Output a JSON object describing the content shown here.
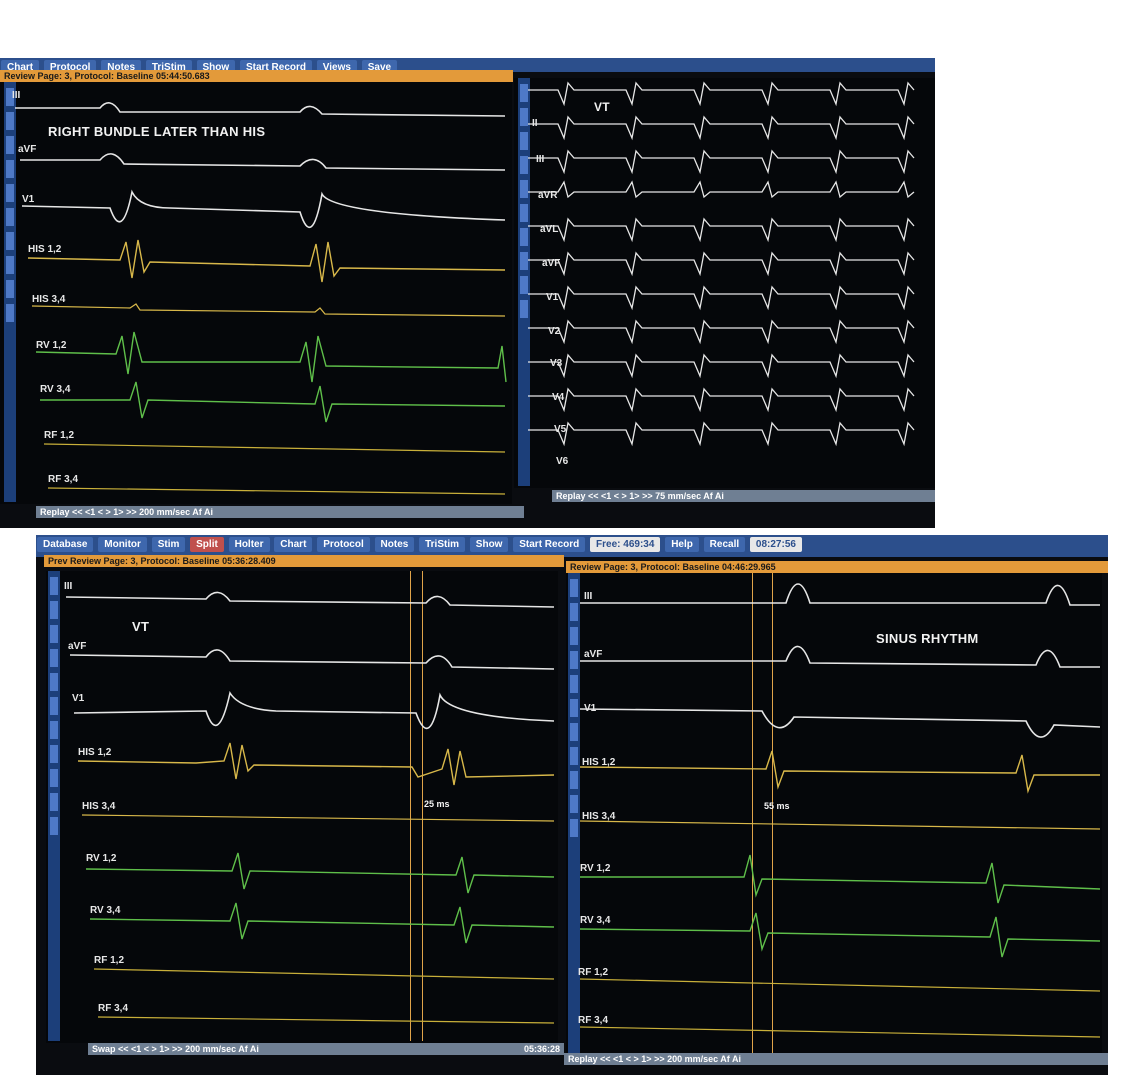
{
  "top_left": {
    "toolbar": [
      "Chart",
      "Protocol",
      "Notes",
      "TriStim",
      "Show",
      "Start Record",
      "Views",
      "Save"
    ],
    "title": "Review Page: 3, Protocol: Baseline  05:44:50.683",
    "note": "RIGHT BUNDLE  LATER THAN HIS",
    "leads": [
      "III",
      "aVF",
      "V1",
      "HIS 1,2",
      "HIS 3,4",
      "RV 1,2",
      "RV 3,4",
      "RF 1,2",
      "RF 3,4"
    ],
    "status": "Replay  <<  <1  <  >  1>  >>  200 mm/sec  Af  Ai"
  },
  "top_right": {
    "note": "VT",
    "leads": [
      "II",
      "III",
      "aVR",
      "aVL",
      "aVF",
      "V1",
      "V2",
      "V3",
      "V4",
      "V5",
      "V6"
    ],
    "status": "Replay  <<  <1  <  >  1>  >>  75  mm/sec  Af  Ai"
  },
  "bottom": {
    "toolbar": [
      "Database",
      "Monitor",
      "Stim",
      "Split",
      "Holter",
      "Chart",
      "Protocol",
      "Notes",
      "TriStim",
      "Show",
      "Start Record",
      "Free: 469:34",
      "Help",
      "Recall",
      "08:27:56"
    ],
    "left": {
      "title": "Prev Review Page: 3, Protocol: Baseline  05:36:28.409",
      "note": "VT",
      "measure": "25 ms",
      "leads": [
        "III",
        "aVF",
        "V1",
        "HIS 1,2",
        "HIS 3,4",
        "RV 1,2",
        "RV 3,4",
        "RF 1,2",
        "RF 3,4"
      ],
      "status": "Swap  <<  <1  <  >  1>  >>  200 mm/sec  Af  Ai",
      "time": "05:36:28"
    },
    "right": {
      "title": "Review Page: 3, Protocol: Baseline  04:46:29.965",
      "note": "SINUS RHYTHM",
      "measure": "55 ms",
      "leads": [
        "III",
        "aVF",
        "V1",
        "HIS 1,2",
        "HIS 3,4",
        "RV 1,2",
        "RV 3,4",
        "RF 1,2",
        "RF 3,4"
      ],
      "status": "Replay  <<  <1  <  >  1>  >>  200 mm/sec  Af  Ai"
    }
  },
  "colors": {
    "ecg": "#e6e6e6",
    "his": "#d8b84a",
    "rv": "#5fbf4a",
    "rf": "#c9b03a",
    "caliper": "#e0a44a"
  }
}
